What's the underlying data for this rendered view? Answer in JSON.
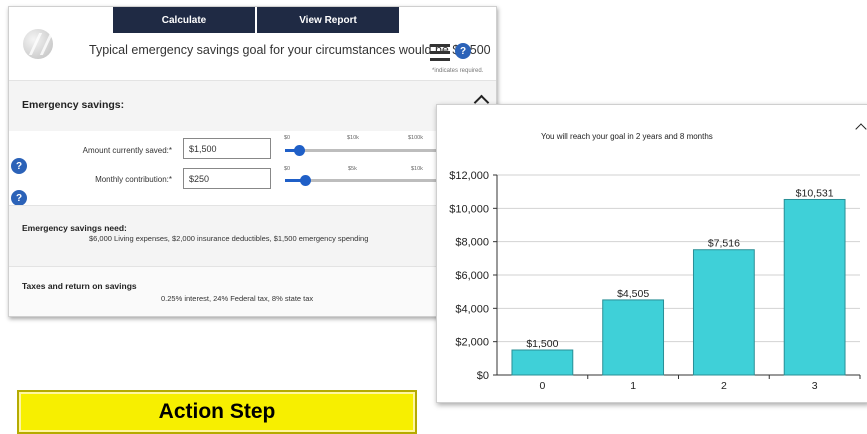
{
  "toolbar": {
    "calculate_label": "Calculate",
    "view_report_label": "View Report"
  },
  "header": {
    "goal_text": "Typical emergency savings goal for your circumstances would be $9,500",
    "required_note": "*indicates required.",
    "help_glyph": "?"
  },
  "emergency_savings": {
    "title": "Emergency savings:",
    "amount": {
      "label": "Amount currently saved:*",
      "value": "$1,500",
      "ticks": [
        "$0",
        "$10k",
        "$100k"
      ],
      "slider_fraction": 0.07
    },
    "monthly": {
      "label": "Monthly contribution:*",
      "value": "$250",
      "ticks": [
        "$0",
        "$5k",
        "$10k"
      ],
      "slider_fraction": 0.09
    }
  },
  "need": {
    "title": "Emergency savings need:",
    "detail": "$6,000 Living expenses, $2,000 insurance deductibles, $1,500 emergency spending"
  },
  "taxes": {
    "title": "Taxes and return on savings",
    "detail": "0.25% interest, 24% Federal tax, 8% state tax"
  },
  "chart_data": {
    "type": "bar",
    "title": "You will reach your goal in 2 years and 8 months",
    "categories": [
      "0",
      "1",
      "2",
      "3"
    ],
    "values": [
      1500,
      4505,
      7516,
      10531
    ],
    "value_labels": [
      "$1,500",
      "$4,505",
      "$7,516",
      "$10,531"
    ],
    "ylim": [
      0,
      12000
    ],
    "yticks": [
      0,
      2000,
      4000,
      6000,
      8000,
      10000,
      12000
    ],
    "ytick_labels": [
      "$0",
      "$2,000",
      "$4,000",
      "$6,000",
      "$8,000",
      "$10,000",
      "$12,000"
    ],
    "bar_color": "#3fd0d8",
    "grid": true,
    "xlabel": "",
    "ylabel": ""
  },
  "action": {
    "label": "Action Step"
  }
}
